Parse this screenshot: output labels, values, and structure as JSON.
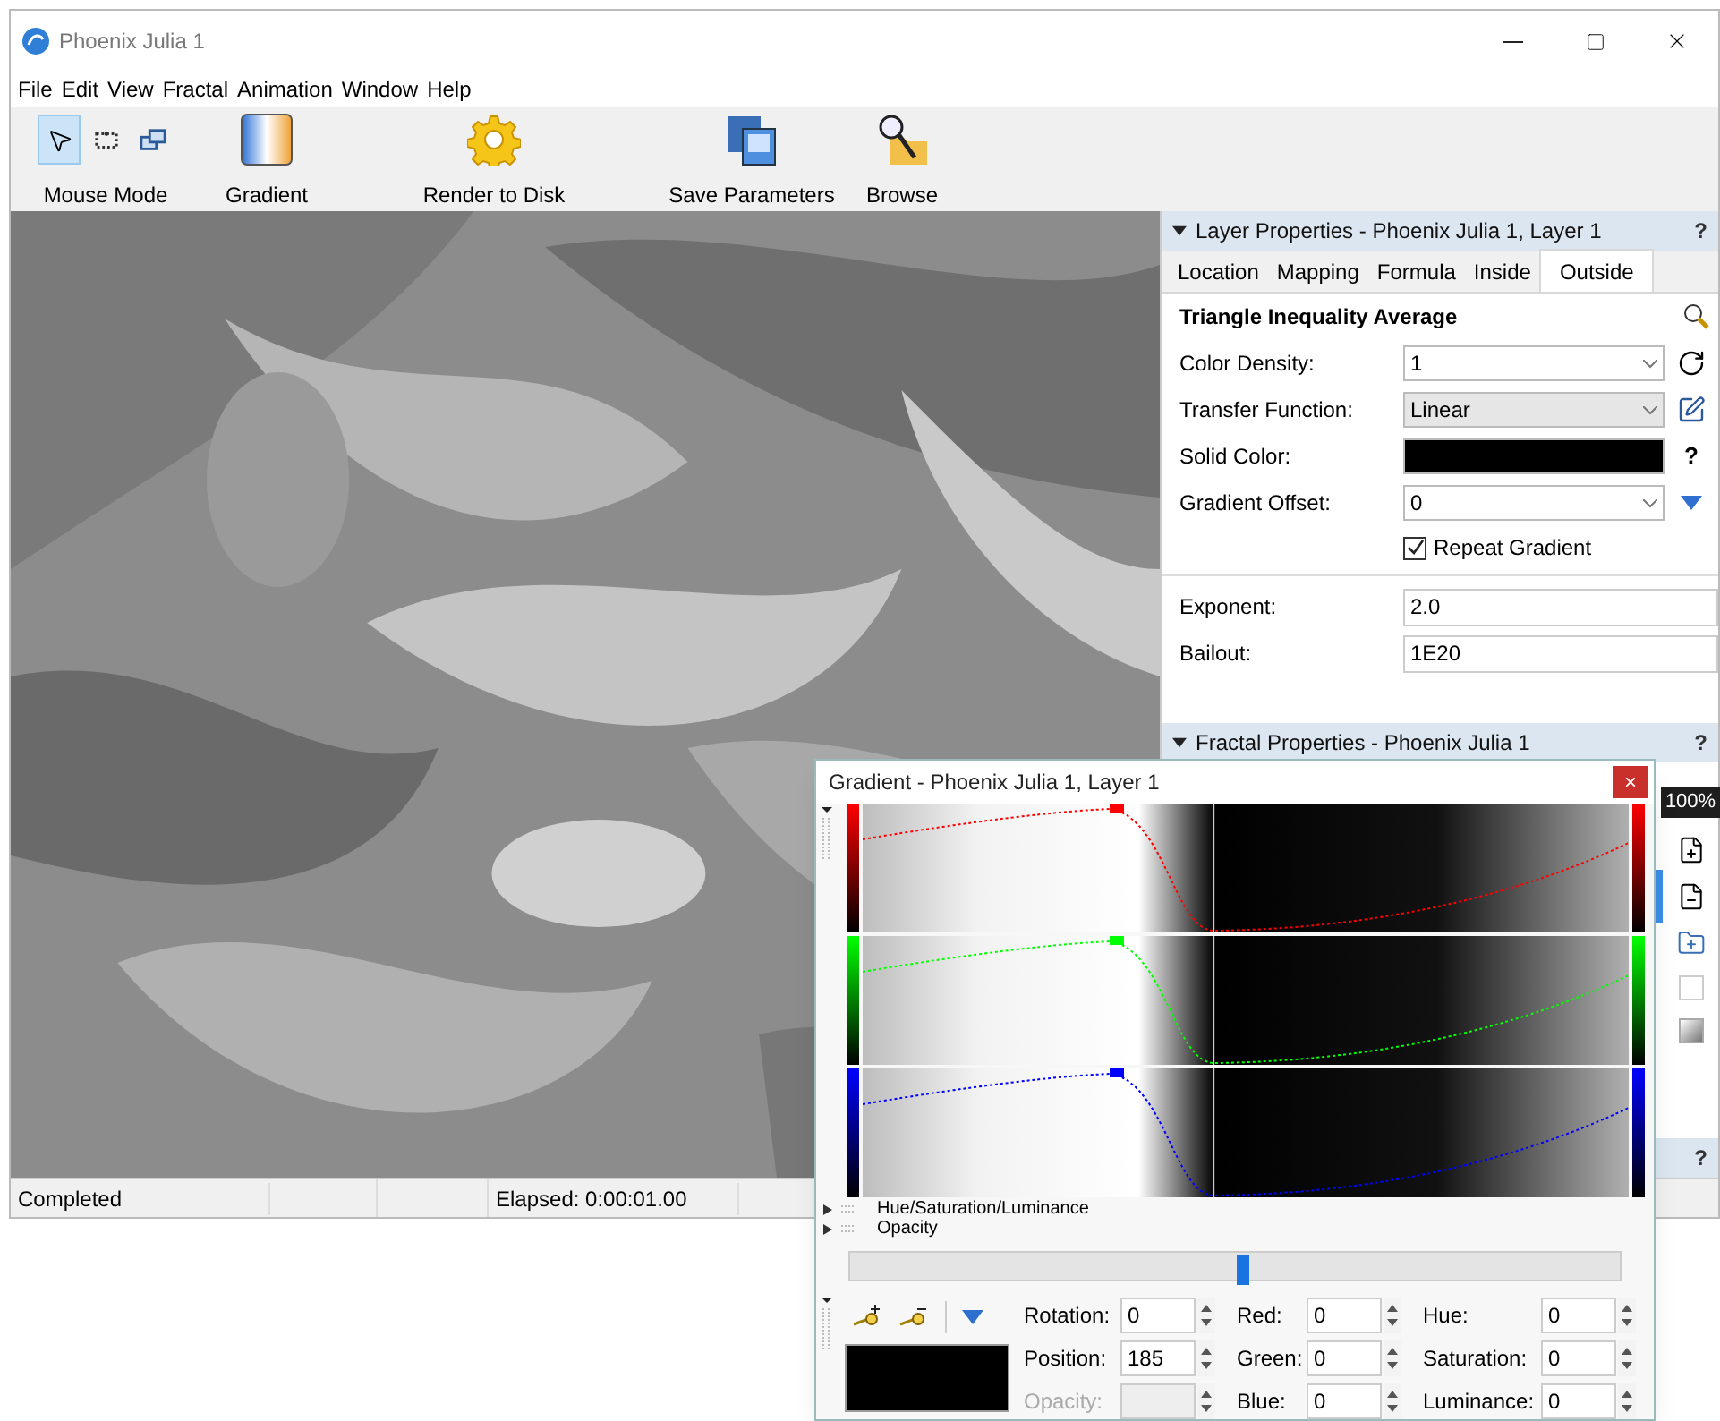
{
  "window": {
    "title": "Phoenix Julia 1"
  },
  "menu": [
    "File",
    "Edit",
    "View",
    "Fractal",
    "Animation",
    "Window",
    "Help"
  ],
  "mouse_modes": [
    {
      "selected": true
    },
    {
      "selected": false
    },
    {
      "selected": false
    }
  ],
  "toolbar": [
    {
      "label": "Mouse Mode",
      "kind": "mouse_mode"
    },
    {
      "label": "Gradient",
      "kind": "gradient"
    },
    {
      "label": "Render to Disk",
      "kind": "render"
    },
    {
      "label": "Save Parameters",
      "kind": "save"
    },
    {
      "label": "Browse",
      "kind": "browse"
    }
  ],
  "layer_panel": {
    "title": "Layer Properties - Phoenix Julia 1, Layer 1",
    "help": "?",
    "tabs": [
      {
        "label": "Location",
        "selected": false
      },
      {
        "label": "Mapping",
        "selected": false
      },
      {
        "label": "Formula",
        "selected": false
      },
      {
        "label": "Inside",
        "selected": false
      },
      {
        "label": "Outside",
        "selected": true
      }
    ],
    "heading": "Triangle Inequality Average",
    "fields": [
      {
        "label": "Color Density:",
        "kind": "combo",
        "value": "1",
        "disabled": false
      },
      {
        "label": "Transfer Function:",
        "kind": "combo",
        "value": "Linear",
        "disabled": true
      },
      {
        "label": "Solid Color:",
        "kind": "color",
        "color": "#000000",
        "help": "?"
      },
      {
        "label": "Gradient Offset:",
        "kind": "combo",
        "value": "0",
        "disabled": false
      }
    ],
    "repeat_gradient": {
      "label": "Repeat Gradient",
      "checked": true
    },
    "params": [
      {
        "label": "Exponent:",
        "value": "2.0"
      },
      {
        "label": "Bailout:",
        "value": "1E20"
      }
    ]
  },
  "fractal_panel": {
    "title": "Fractal Properties - Phoenix Julia 1",
    "help": "?",
    "zoom": "100%"
  },
  "next_panel": {
    "help": "?"
  },
  "status_bar": {
    "status": "Completed",
    "elapsed": "Elapsed: 0:00:01.00"
  },
  "gradient_window": {
    "title": "Gradient - Phoenix Julia 1, Layer 1",
    "close": "×",
    "channels": [
      {
        "color": "#ff0000"
      },
      {
        "color": "#00ff00"
      },
      {
        "color": "#0000ff"
      }
    ],
    "sections": [
      {
        "label": "Hue/Saturation/Luminance",
        "expanded": false
      },
      {
        "label": "Opacity",
        "expanded": false
      }
    ],
    "slider": {
      "level": 0.51
    },
    "swatch": {
      "color": "#000000"
    },
    "columns": [
      [
        {
          "label": "Rotation:",
          "value": "0",
          "disabled": false
        },
        {
          "label": "Position:",
          "value": "185",
          "disabled": false
        },
        {
          "label": "Opacity:",
          "disabled": true
        }
      ],
      [
        {
          "label": "Red:",
          "value": "0",
          "disabled": false
        },
        {
          "label": "Green:",
          "value": "0",
          "disabled": false
        },
        {
          "label": "Blue:",
          "value": "0",
          "disabled": false
        }
      ],
      [
        {
          "label": "Hue:",
          "value": "0",
          "disabled": false
        },
        {
          "label": "Saturation:",
          "value": "0",
          "disabled": false
        },
        {
          "label": "Luminance:",
          "value": "0",
          "disabled": false
        }
      ]
    ]
  }
}
